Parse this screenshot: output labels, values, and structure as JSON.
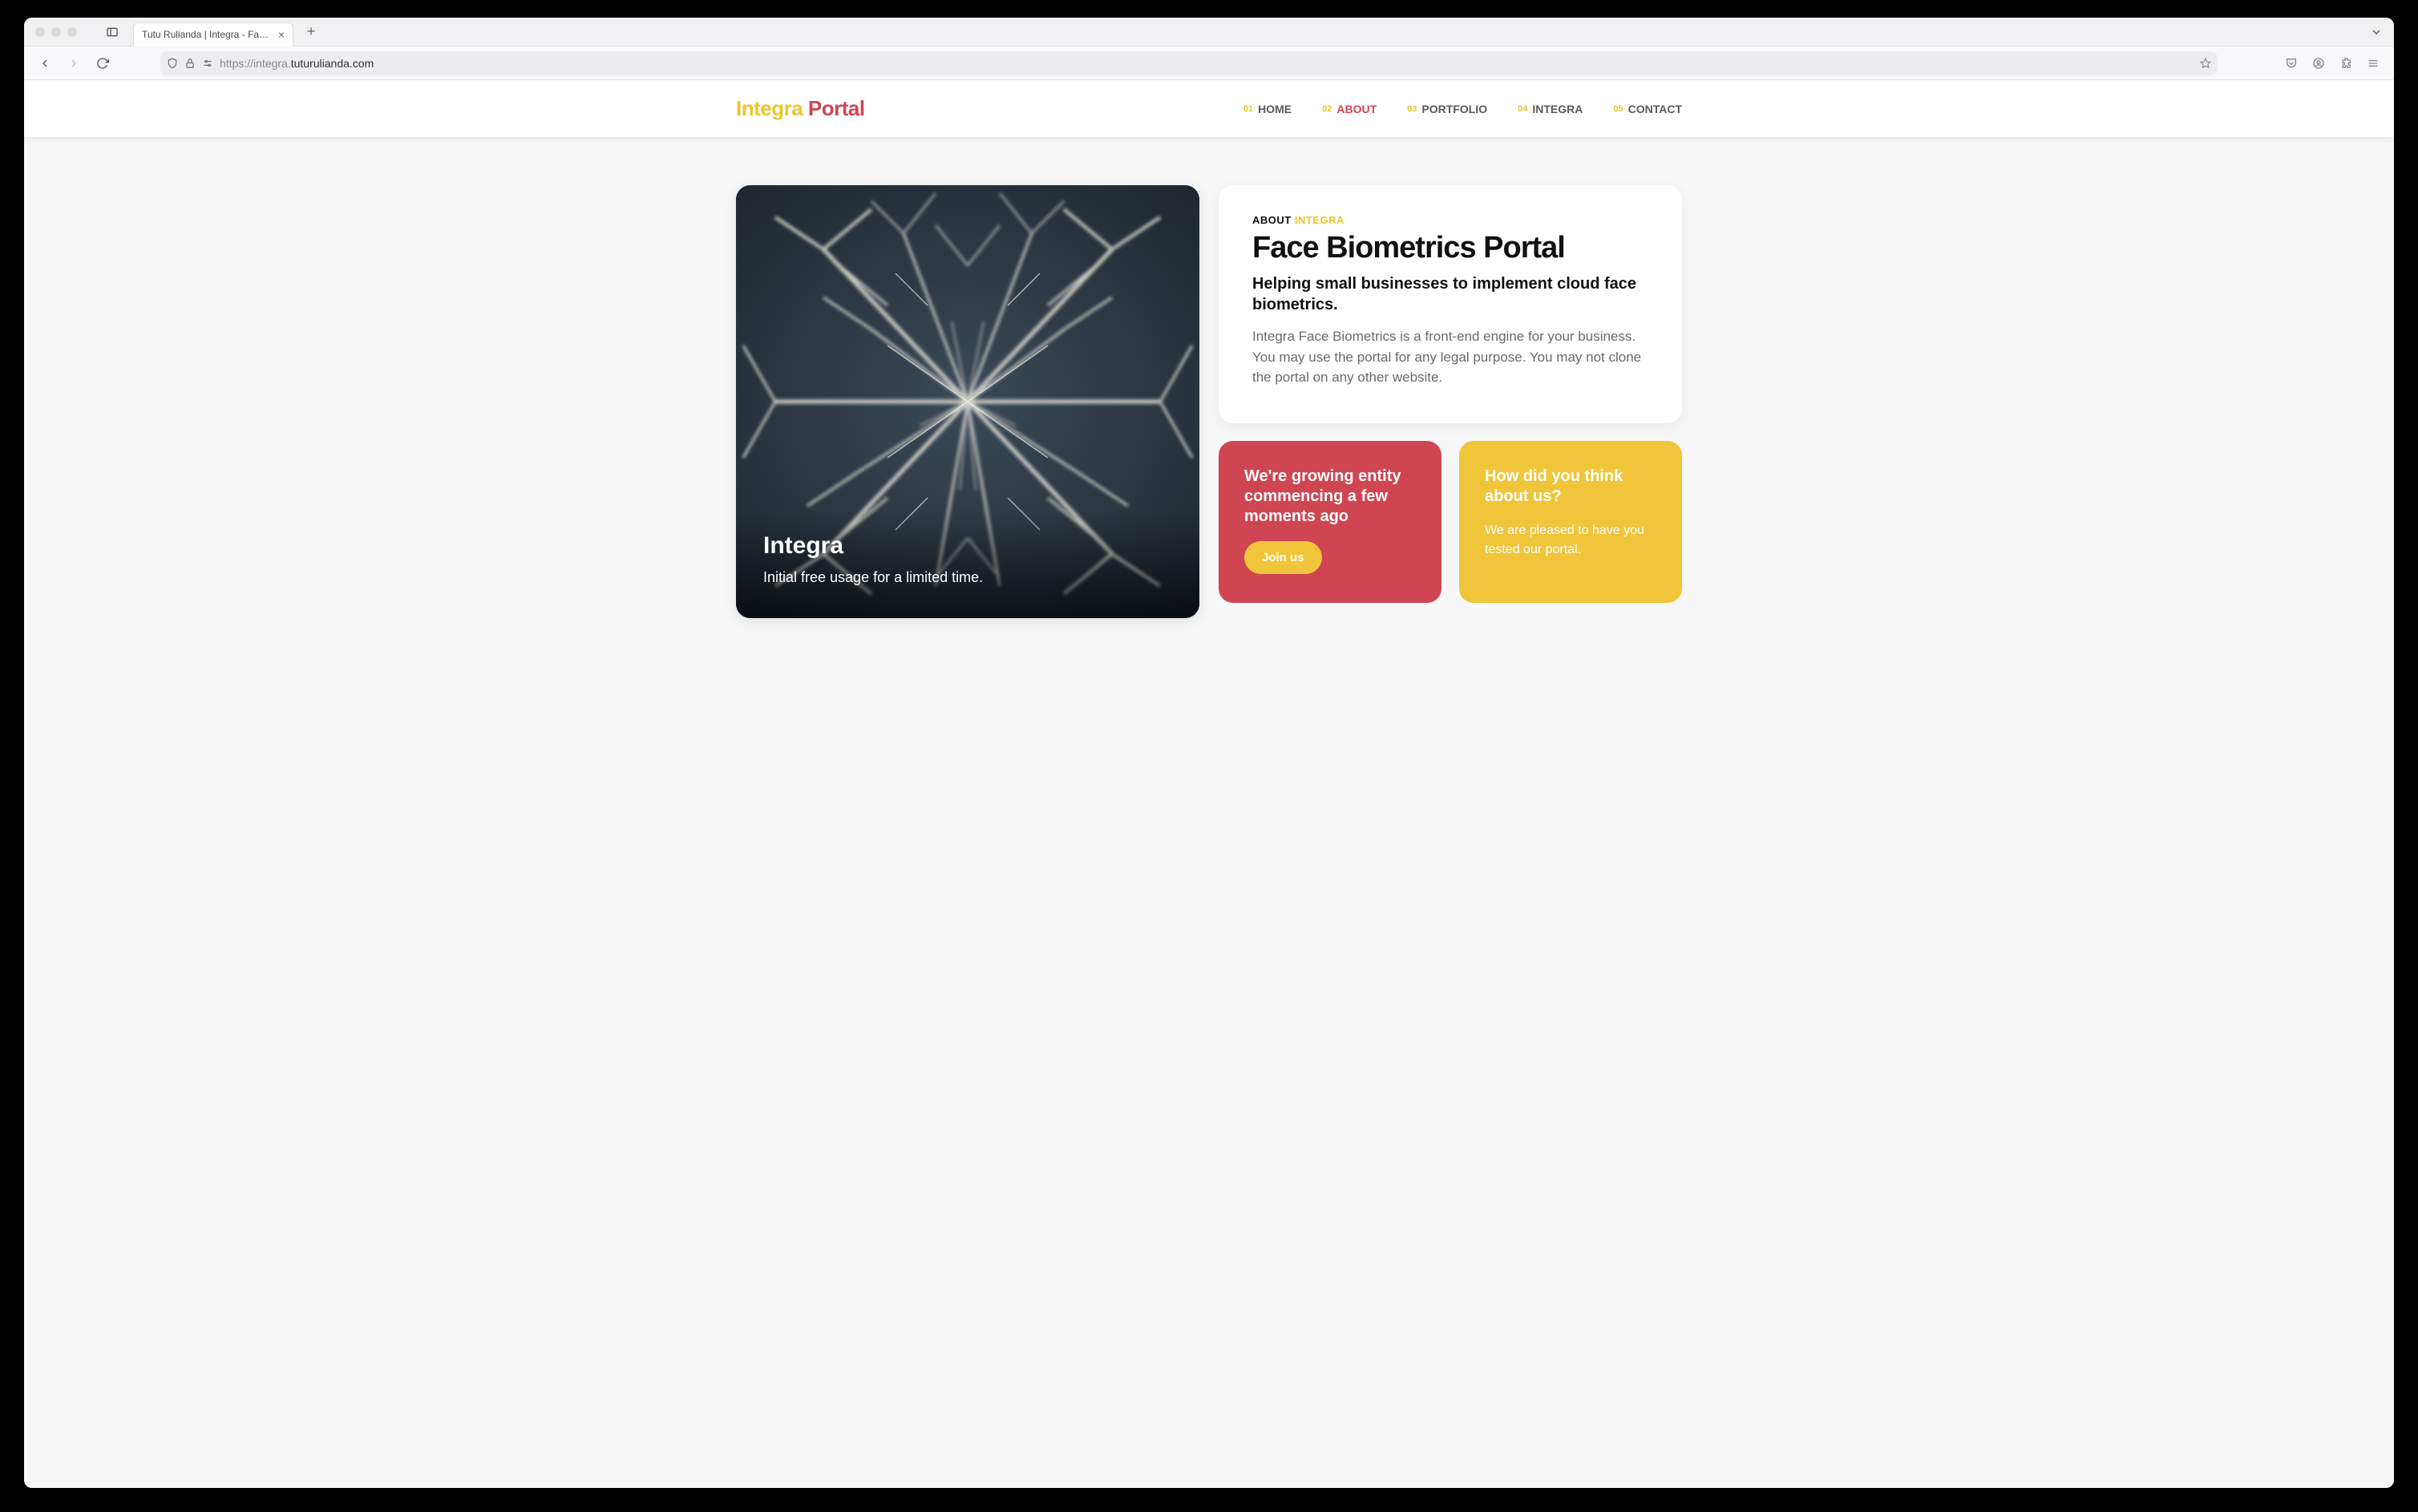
{
  "browser": {
    "tab_title": "Tutu Rulianda | Integra - Face Biome",
    "url_protocol": "https://",
    "url_sub": "integra.",
    "url_domain": "tuturulianda.com"
  },
  "header": {
    "logo_p1": "Integra",
    "logo_p2": "Portal",
    "nav": [
      {
        "num": "01",
        "label": "HOME",
        "active": false
      },
      {
        "num": "02",
        "label": "ABOUT",
        "active": true
      },
      {
        "num": "03",
        "label": "PORTFOLIO",
        "active": false
      },
      {
        "num": "04",
        "label": "INTEGRA",
        "active": false
      },
      {
        "num": "05",
        "label": "CONTACT",
        "active": false
      }
    ]
  },
  "hero": {
    "title": "Integra",
    "subtitle": "Initial free usage for a limited time."
  },
  "about": {
    "label_p1": "ABOUT",
    "label_p2": "INTEGRA",
    "title": "Face Biometrics Portal",
    "subtitle": "Helping small businesses to implement cloud face biometrics.",
    "body": "Integra Face Biometrics is a front-end engine for your business. You may use the portal for any legal purpose. You may not clone the portal on any other website."
  },
  "cards": {
    "red": {
      "title": "We're growing entity commencing a few moments ago",
      "cta": "Join us"
    },
    "yellow": {
      "title": "How did you think about us?",
      "body": "We are pleased to have you tested our portal."
    }
  },
  "colors": {
    "accent_yellow": "#ecc52c",
    "accent_red": "#cf4552"
  }
}
